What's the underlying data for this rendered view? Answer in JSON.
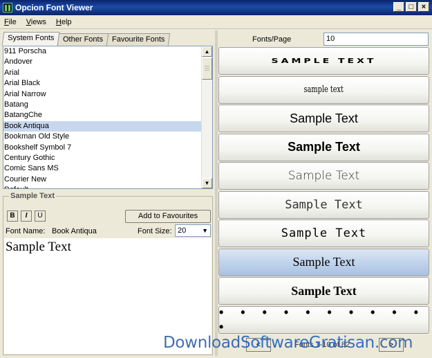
{
  "window": {
    "title": "Opcion Font Viewer"
  },
  "menu": [
    "File",
    "Views",
    "Help"
  ],
  "tabs": [
    "System Fonts",
    "Other Fonts",
    "Favourite Fonts"
  ],
  "fonts": [
    "911 Porscha",
    "Andover",
    "Arial",
    "Arial Black",
    "Arial Narrow",
    "Batang",
    "BatangChe",
    "Book Antiqua",
    "Bookman Old Style",
    "Bookshelf Symbol 7",
    "Century Gothic",
    "Comic Sans MS",
    "Courier New",
    "Default"
  ],
  "selected_font_index": 7,
  "sample_panel": {
    "legend": "Sample Text",
    "bold": "B",
    "italic": "I",
    "underline": "U",
    "add_to_favourites": "Add to Favourites",
    "font_name_label": "Font Name:",
    "font_name_value": "Book Antiqua",
    "font_size_label": "Font Size:",
    "font_size_value": "20",
    "preview_text": "Sample Text"
  },
  "right_panel": {
    "fonts_per_page_label": "Fonts/Page",
    "fonts_per_page_value": "10",
    "samples": [
      "SAMPLE TEXT",
      "sample text",
      "Sample Text",
      "Sample Text",
      "Sample Text",
      "Sample Text",
      "Sample Text",
      "Sample Text",
      "Sample Text",
      "• • • • • • • • • • •"
    ],
    "selected_sample_index": 7,
    "pager": {
      "prev": "<",
      "info": "Fonts 1-10 of 82",
      "next": ">"
    }
  },
  "watermark": {
    "part1": "Download",
    "part2": "SoftwareGratisan",
    "part3": ".com"
  }
}
